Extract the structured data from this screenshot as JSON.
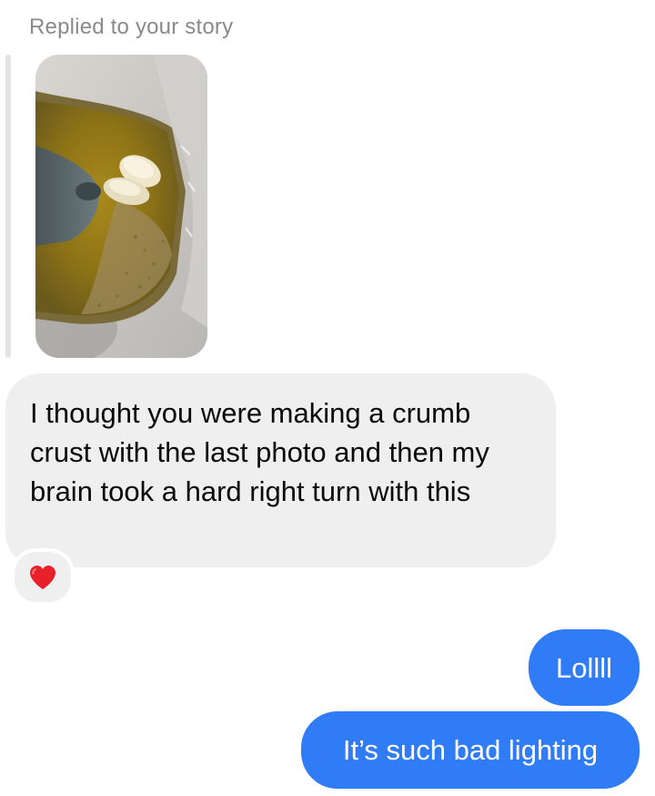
{
  "story_reply": {
    "header": "Replied to your story",
    "image_description_icon": "story-photo-icon"
  },
  "messages": [
    {
      "direction": "incoming",
      "text": "I thought you were making a crumb crust with the last photo and then my brain took a hard right turn with this",
      "reaction": "heart-icon"
    },
    {
      "direction": "outgoing",
      "text": "Lollll"
    },
    {
      "direction": "outgoing",
      "text": "It’s such bad lighting"
    }
  ],
  "colors": {
    "incoming_bubble": "#efefef",
    "outgoing_bubble": "#2f7cf6",
    "secondary_text": "#8a8a8e",
    "reaction_heart": "#e8202a"
  }
}
